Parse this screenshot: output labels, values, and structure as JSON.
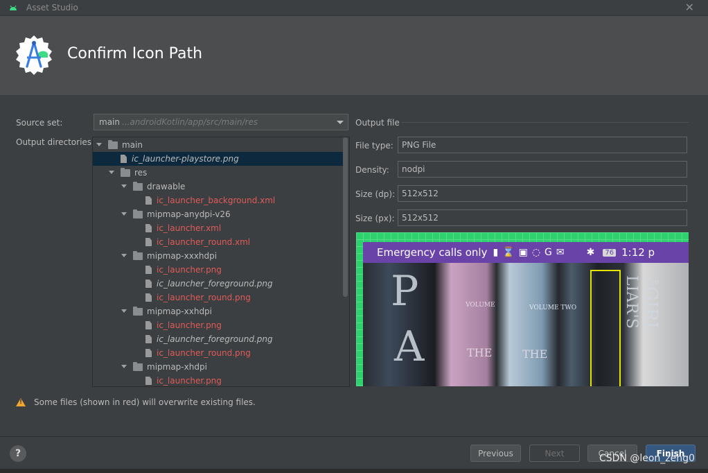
{
  "window": {
    "title": "Asset Studio",
    "close_glyph": "✕"
  },
  "header": {
    "title": "Confirm Icon Path"
  },
  "source_set": {
    "label": "Source set:",
    "value": "main",
    "path": "...androidKotlin/app/src/main/res"
  },
  "output_directories": {
    "label": "Output directories:",
    "tree": [
      {
        "name": "main",
        "type": "folder",
        "depth": 0,
        "expanded": true,
        "color": "normal"
      },
      {
        "name": "ic_launcher-playstore.png",
        "type": "file",
        "depth": 1,
        "color": "normal",
        "italic": true,
        "selected": true
      },
      {
        "name": "res",
        "type": "folder",
        "depth": 1,
        "expanded": true,
        "color": "normal"
      },
      {
        "name": "drawable",
        "type": "folder",
        "depth": 2,
        "expanded": true,
        "color": "normal"
      },
      {
        "name": "ic_launcher_background.xml",
        "type": "file",
        "depth": 3,
        "color": "red"
      },
      {
        "name": "mipmap-anydpi-v26",
        "type": "folder",
        "depth": 2,
        "expanded": true,
        "color": "normal"
      },
      {
        "name": "ic_launcher.xml",
        "type": "file",
        "depth": 3,
        "color": "red"
      },
      {
        "name": "ic_launcher_round.xml",
        "type": "file",
        "depth": 3,
        "color": "red"
      },
      {
        "name": "mipmap-xxxhdpi",
        "type": "folder",
        "depth": 2,
        "expanded": true,
        "color": "normal"
      },
      {
        "name": "ic_launcher.png",
        "type": "file",
        "depth": 3,
        "color": "red"
      },
      {
        "name": "ic_launcher_foreground.png",
        "type": "file",
        "depth": 3,
        "color": "normal",
        "italic": true
      },
      {
        "name": "ic_launcher_round.png",
        "type": "file",
        "depth": 3,
        "color": "red"
      },
      {
        "name": "mipmap-xxhdpi",
        "type": "folder",
        "depth": 2,
        "expanded": true,
        "color": "normal"
      },
      {
        "name": "ic_launcher.png",
        "type": "file",
        "depth": 3,
        "color": "red"
      },
      {
        "name": "ic_launcher_foreground.png",
        "type": "file",
        "depth": 3,
        "color": "normal",
        "italic": true
      },
      {
        "name": "ic_launcher_round.png",
        "type": "file",
        "depth": 3,
        "color": "red"
      },
      {
        "name": "mipmap-xhdpi",
        "type": "folder",
        "depth": 2,
        "expanded": true,
        "color": "normal"
      },
      {
        "name": "ic_launcher.png",
        "type": "file",
        "depth": 3,
        "color": "red"
      }
    ]
  },
  "output_file": {
    "heading": "Output file",
    "file_type_label": "File type:",
    "file_type": "PNG File",
    "density_label": "Density:",
    "density": "nodpi",
    "size_dp_label": "Size (dp):",
    "size_dp": "512x512",
    "size_px_label": "Size (px):",
    "size_px": "512x512"
  },
  "preview": {
    "status_text": "Emergency calls only",
    "battery": "76",
    "time": "1:12 p",
    "cover_letters": [
      "P",
      "A",
      "The",
      "GIRL",
      "LIAR'S",
      "THE",
      "THE",
      "VOLUME",
      "VOLUME TWO"
    ]
  },
  "warning": {
    "text": "Some files (shown in red) will overwrite existing files."
  },
  "buttons": {
    "help": "?",
    "previous": "Previous",
    "next": "Next",
    "cancel": "Cancel",
    "finish": "Finish"
  },
  "watermark": "CSDN @leon_zeng0",
  "colors": {
    "red_file": "#e05a5a",
    "selection": "#0d293e",
    "primary": "#365880",
    "android_green": "#3ddc84"
  }
}
